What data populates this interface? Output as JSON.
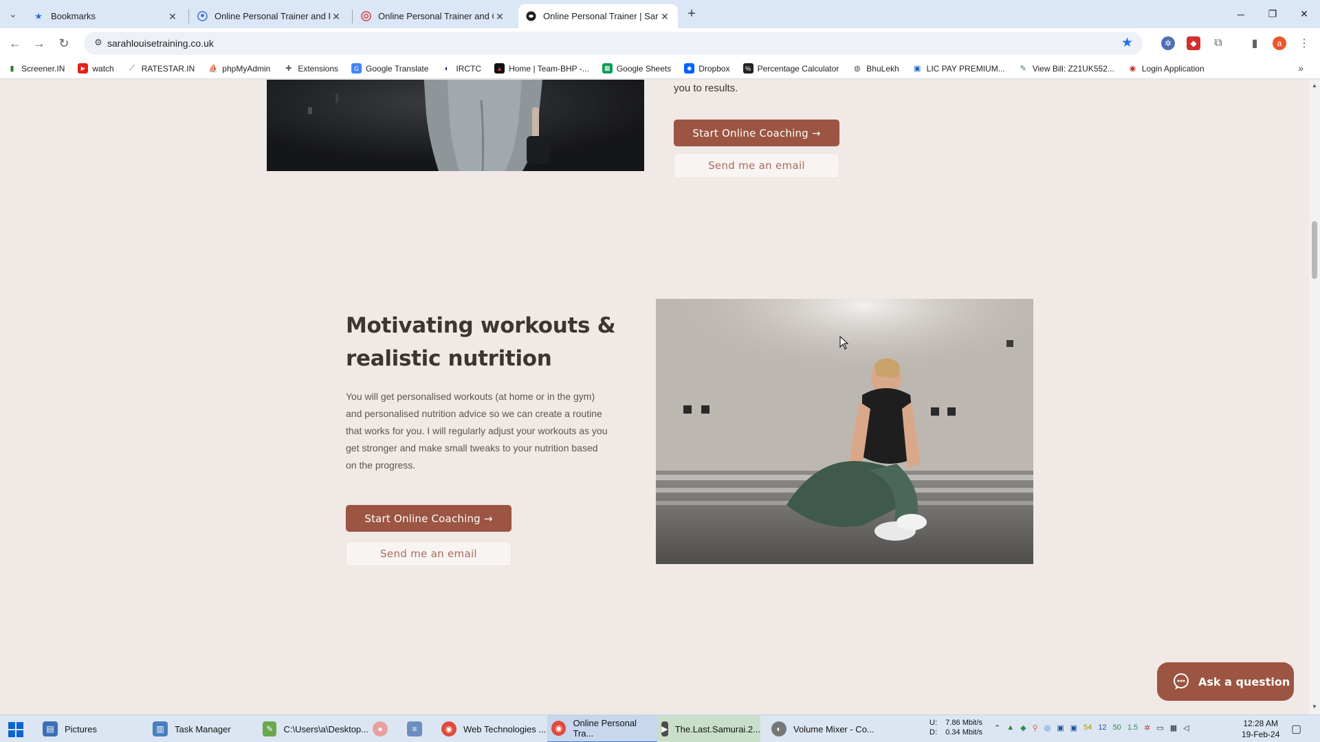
{
  "browser": {
    "tabs": [
      {
        "title": "Bookmarks",
        "favicon": "star-icon",
        "active": false
      },
      {
        "title": "Online Personal Trainer and Fit",
        "favicon": "site-icon",
        "active": false
      },
      {
        "title": "Online Personal Trainer and Onl",
        "favicon": "site-icon",
        "active": false
      },
      {
        "title": "Online Personal Trainer | Sarah",
        "favicon": "site-icon",
        "active": true
      }
    ],
    "url": "sarahlouisetraining.co.uk",
    "profile_initial": "a"
  },
  "bookmarks": [
    {
      "label": "Screener.IN",
      "icon": "bar-chart-icon",
      "color": "#2e7d32"
    },
    {
      "label": "watch",
      "icon": "youtube-icon",
      "color": "#e62117"
    },
    {
      "label": "RATESTAR.IN",
      "icon": "ratestar-icon",
      "color": "#555555"
    },
    {
      "label": "phpMyAdmin",
      "icon": "phpmyadmin-icon",
      "color": "#f29111"
    },
    {
      "label": "Extensions",
      "icon": "puzzle-icon",
      "color": "#5f6368"
    },
    {
      "label": "Google Translate",
      "icon": "translate-icon",
      "color": "#4285f4"
    },
    {
      "label": "IRCTC",
      "icon": "irctc-icon",
      "color": "#1a237e"
    },
    {
      "label": "Home | Team-BHP -...",
      "icon": "teambhp-icon",
      "color": "#b71c1c"
    },
    {
      "label": "Google Sheets",
      "icon": "sheets-icon",
      "color": "#0f9d58"
    },
    {
      "label": "Dropbox",
      "icon": "dropbox-icon",
      "color": "#0061fe"
    },
    {
      "label": "Percentage Calculator",
      "icon": "percent-icon",
      "color": "#222222"
    },
    {
      "label": "BhuLekh",
      "icon": "globe-icon",
      "color": "#555555"
    },
    {
      "label": "LIC PAY PREMIUM...",
      "icon": "lic-icon",
      "color": "#1565c0"
    },
    {
      "label": "View Bill: Z21UK552...",
      "icon": "bill-icon",
      "color": "#2e7d32"
    },
    {
      "label": "Login Application",
      "icon": "login-icon",
      "color": "#c62828"
    }
  ],
  "page": {
    "intro_tail": "you to results.",
    "top_cta": {
      "primary": "Start Online Coaching →",
      "secondary": "Send me an email"
    },
    "section": {
      "heading": "Motivating workouts & realistic nutrition",
      "body": "You will get personalised workouts (at home or in the gym) and personalised nutrition advice so we can create a routine that works for you. I  will regularly adjust your workouts as you get stronger and make small tweaks to your nutrition based on the progress.",
      "primary": "Start Online Coaching →",
      "secondary": "Send me an email"
    },
    "chat_button": "Ask a question",
    "colors": {
      "brand": "#9b5542",
      "background": "#f0e9e5"
    }
  },
  "taskbar": {
    "items": [
      {
        "label": "Pictures",
        "icon": "folder-icon",
        "color": "#3d6fb6",
        "active": false
      },
      {
        "label": "Task Manager",
        "icon": "task-manager-icon",
        "color": "#4a7fbf",
        "active": false
      },
      {
        "label": "C:\\Users\\a\\Desktop...",
        "icon": "notepad-plus-icon",
        "color": "#6aa84f",
        "active": false
      },
      {
        "label": "",
        "icon": "app-icon",
        "color": "#e8a0a0",
        "active": false
      },
      {
        "label": "",
        "icon": "notepad-icon",
        "color": "#6c8fbf",
        "active": false
      },
      {
        "label": "Web Technologies ...",
        "icon": "chrome-icon",
        "color": "#e04b3c",
        "active": false
      },
      {
        "label": "Online Personal Tra...",
        "icon": "chrome-icon",
        "color": "#e04b3c",
        "active": true
      },
      {
        "label": "The.Last.Samurai.2...",
        "icon": "media-player-icon",
        "color": "#4c4c4c",
        "active": false
      },
      {
        "label": "Volume Mixer - Co...",
        "icon": "speaker-icon",
        "color": "#777777",
        "active": false
      }
    ],
    "net_up_label": "U:",
    "net_down_label": "D:",
    "net_up": "7.86 Mbit/s",
    "net_down": "0.34 Mbit/s",
    "tray_numbers": [
      "54",
      "12",
      "50",
      "1.5"
    ],
    "time": "12:28 AM",
    "date": "19-Feb-24"
  }
}
